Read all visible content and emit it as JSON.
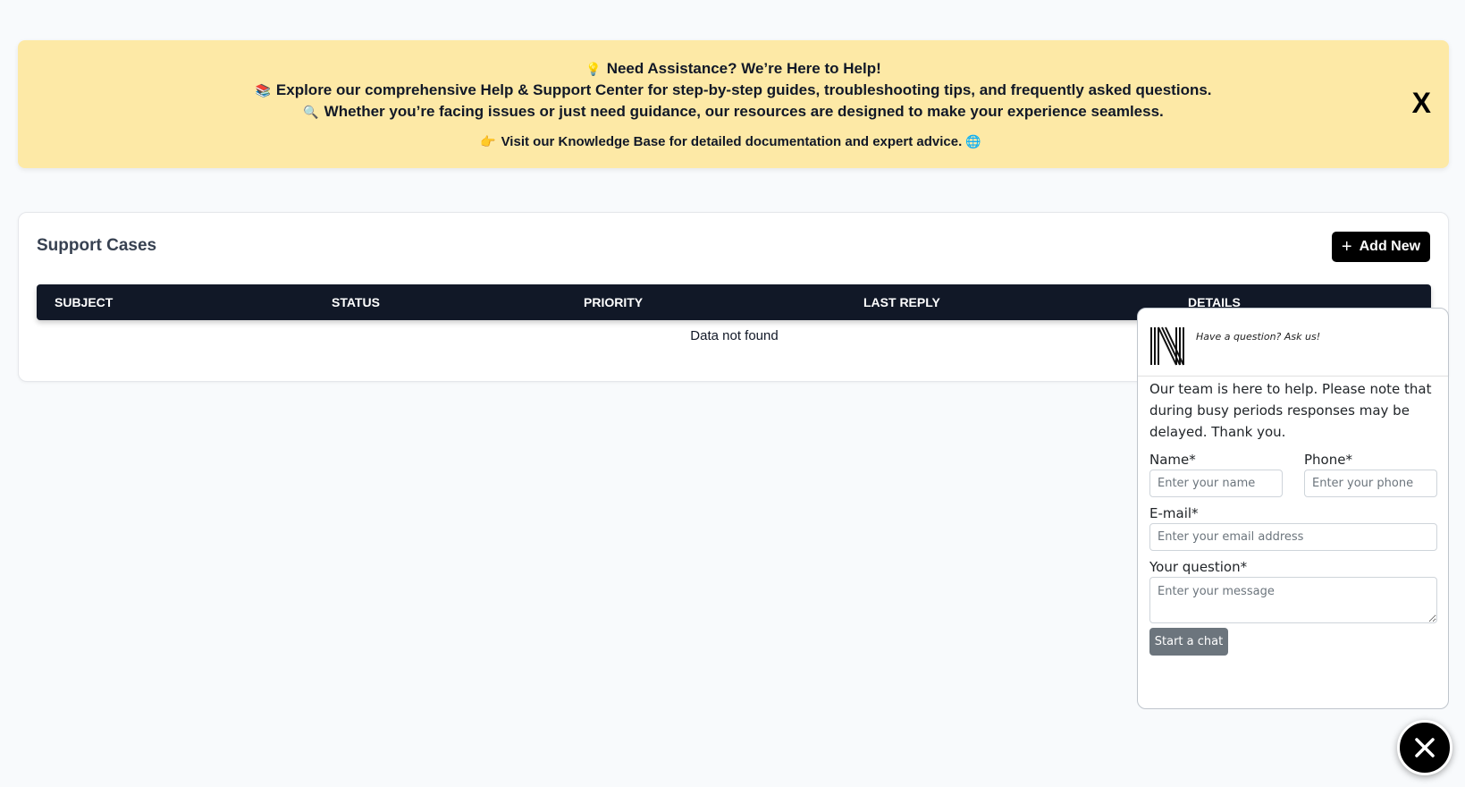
{
  "banner": {
    "line1_emoji": "💡",
    "line1": "Need Assistance? We’re Here to Help!",
    "line2_emoji": "📚",
    "line2_pre": "Explore our comprehensive ",
    "line2_bold": "Help & Support Center",
    "line2_post": " for step-by-step guides, troubleshooting tips, and frequently asked questions.",
    "line3_emoji": "🔍",
    "line3": "Whether you’re facing issues or just need guidance, our resources are designed to make your experience seamless.",
    "line4_emoji": "👉",
    "line4": "Visit our Knowledge Base for detailed documentation and expert advice.",
    "line4_end_emoji": "🌐",
    "close_label": "X"
  },
  "cases": {
    "title": "Support Cases",
    "add_label": "Add New",
    "add_icon": "+",
    "columns": [
      "SUBJECT",
      "STATUS",
      "PRIORITY",
      "LAST REPLY",
      "DETAILS"
    ],
    "empty_text": "Data not found"
  },
  "chat": {
    "tagline": "Have a question? Ask us!",
    "intro": "Our team is here to help. Please note that during busy periods responses may be delayed. Thank you.",
    "name_label": "Name*",
    "name_placeholder": "Enter your name",
    "name_value": "",
    "phone_label": "Phone*",
    "phone_placeholder": "Enter your phone",
    "phone_value": "",
    "email_label": "E-mail*",
    "email_placeholder": "Enter your email address",
    "email_value": "",
    "question_label": "Your question*",
    "question_placeholder": "Enter your message",
    "question_value": "",
    "start_label": "Start a chat"
  },
  "fab": {
    "icon": "close-icon"
  },
  "colors": {
    "banner_bg": "#fde9a6",
    "table_header_bg": "#111827",
    "primary_button": "#000000",
    "start_button": "#6c757d"
  }
}
